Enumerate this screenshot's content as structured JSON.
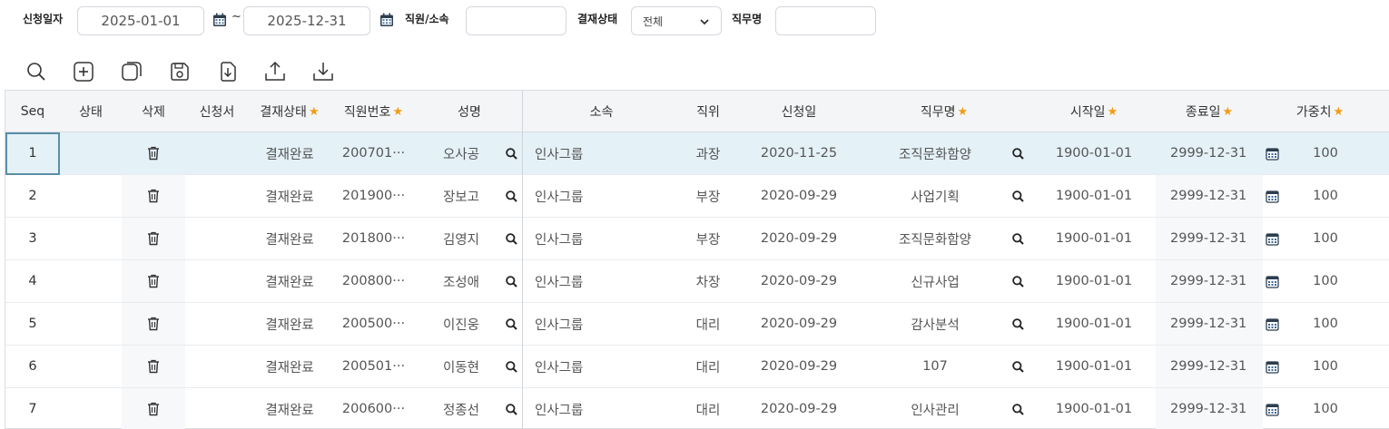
{
  "filters": {
    "apply_date_label": "신청일자",
    "date_from": "2025-01-01",
    "date_to": "2025-12-31",
    "tilde": "~",
    "employee_label": "직원/소속",
    "employee_value": "",
    "approval_label": "결재상태",
    "approval_value": "전체",
    "duty_label": "직무명",
    "duty_value": ""
  },
  "toolbar": [
    "search-icon",
    "add-icon",
    "copy-icon",
    "save-icon",
    "file-download-icon",
    "upload-icon",
    "download-icon"
  ],
  "columns": {
    "seq": "Seq",
    "state": "상태",
    "delete": "삭제",
    "form": "신청서",
    "approval": "결재상태",
    "emp_no": "직원번호",
    "name": "성명",
    "dept": "소속",
    "position": "직위",
    "apply_date": "신청일",
    "duty": "직무명",
    "start": "시작일",
    "end": "종료일",
    "weight": "가중치"
  },
  "rows": [
    {
      "seq": "1",
      "approval": "결재완료",
      "emp_no": "200701···",
      "name": "오사공",
      "dept": "인사그룹",
      "position": "과장",
      "apply_date": "2020-11-25",
      "duty": "조직문화함양",
      "start": "1900-01-01",
      "end": "2999-12-31",
      "weight": "100"
    },
    {
      "seq": "2",
      "approval": "결재완료",
      "emp_no": "201900···",
      "name": "장보고",
      "dept": "인사그룹",
      "position": "부장",
      "apply_date": "2020-09-29",
      "duty": "사업기획",
      "start": "1900-01-01",
      "end": "2999-12-31",
      "weight": "100"
    },
    {
      "seq": "3",
      "approval": "결재완료",
      "emp_no": "201800···",
      "name": "김영지",
      "dept": "인사그룹",
      "position": "부장",
      "apply_date": "2020-09-29",
      "duty": "조직문화함양",
      "start": "1900-01-01",
      "end": "2999-12-31",
      "weight": "100"
    },
    {
      "seq": "4",
      "approval": "결재완료",
      "emp_no": "200800···",
      "name": "조성애",
      "dept": "인사그룹",
      "position": "차장",
      "apply_date": "2020-09-29",
      "duty": "신규사업",
      "start": "1900-01-01",
      "end": "2999-12-31",
      "weight": "100"
    },
    {
      "seq": "5",
      "approval": "결재완료",
      "emp_no": "200500···",
      "name": "이진웅",
      "dept": "인사그룹",
      "position": "대리",
      "apply_date": "2020-09-29",
      "duty": "감사분석",
      "start": "1900-01-01",
      "end": "2999-12-31",
      "weight": "100"
    },
    {
      "seq": "6",
      "approval": "결재완료",
      "emp_no": "200501···",
      "name": "이동현",
      "dept": "인사그룹",
      "position": "대리",
      "apply_date": "2020-09-29",
      "duty": "107",
      "start": "1900-01-01",
      "end": "2999-12-31",
      "weight": "100"
    },
    {
      "seq": "7",
      "approval": "결재완료",
      "emp_no": "200600···",
      "name": "정종선",
      "dept": "인사그룹",
      "position": "대리",
      "apply_date": "2020-09-29",
      "duty": "인사관리",
      "start": "1900-01-01",
      "end": "2999-12-31",
      "weight": "100"
    }
  ],
  "colors": {
    "accent_star": "#f39c12",
    "selected_row": "#e4f1f7",
    "selected_border": "#5a8fa8"
  }
}
